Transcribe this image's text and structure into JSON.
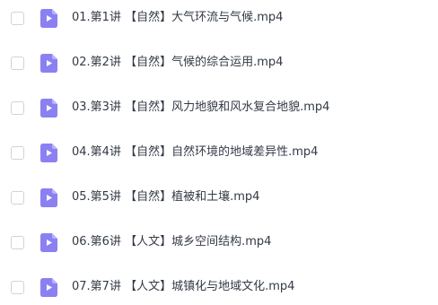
{
  "files": [
    {
      "name": "01.第1讲 【自然】大气环流与气候.mp4",
      "icon": "video-file-icon"
    },
    {
      "name": "02.第2讲 【自然】气候的综合运用.mp4",
      "icon": "video-file-icon"
    },
    {
      "name": "03.第3讲 【自然】风力地貌和风水复合地貌.mp4",
      "icon": "video-file-icon"
    },
    {
      "name": "04.第4讲 【自然】自然环境的地域差异性.mp4",
      "icon": "video-file-icon"
    },
    {
      "name": "05.第5讲 【自然】植被和土壤.mp4",
      "icon": "video-file-icon"
    },
    {
      "name": "06.第6讲 【人文】城乡空间结构.mp4",
      "icon": "video-file-icon"
    },
    {
      "name": "07.第7讲 【人文】城镇化与地域文化.mp4",
      "icon": "video-file-icon"
    }
  ],
  "colors": {
    "icon_fill": "#8b80f2",
    "icon_fold": "#b9b2f8",
    "text": "#333a45",
    "checkbox_border": "#cfd3d9"
  }
}
